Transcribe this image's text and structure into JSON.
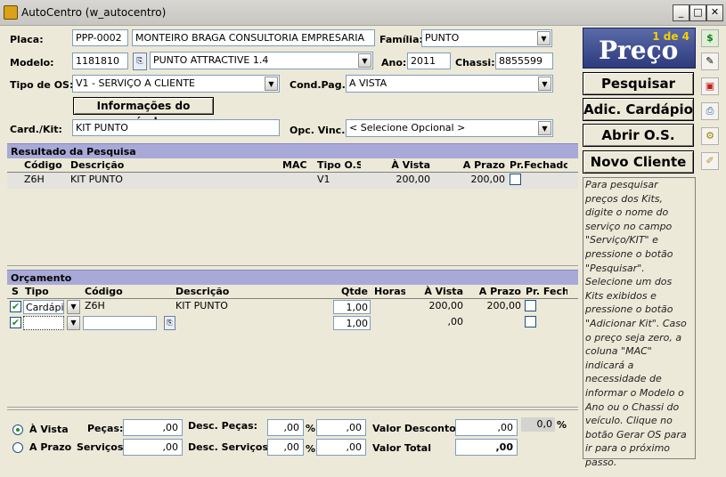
{
  "window": {
    "title": "AutoCentro (w_autocentro)"
  },
  "form": {
    "placa_label": "Placa:",
    "placa": "PPP-0002",
    "cliente": "MONTEIRO BRAGA CONSULTORIA EMPRESARIA",
    "familia_label": "Família:",
    "familia": "PUNTO",
    "modelo_label": "Modelo:",
    "modelo_code": "1181810",
    "modelo": "PUNTO ATTRACTIVE 1.4",
    "ano_label": "Ano:",
    "ano": "2011",
    "chassi_label": "Chassi:",
    "chassi": "8855599",
    "tipo_os_label": "Tipo de OS:",
    "tipo_os": "V1 - SERVIÇO A CLIENTE",
    "cond_pag_label": "Cond.Pag.:",
    "cond_pag": "A VISTA",
    "info_button": "Informações do veículo",
    "card_kit_label": "Card./Kit:",
    "card_kit": "KIT PUNTO",
    "opc_vinc_label": "Opc. Vinc.:",
    "opc_vinc": "< Selecione Opcional >"
  },
  "resultado": {
    "title": "Resultado da Pesquisa",
    "columns": [
      "Código",
      "Descrição",
      "MAC",
      "Tipo O.S",
      "À Vista",
      "A Prazo",
      "Pr.Fechado"
    ],
    "rows": [
      {
        "codigo": "Z6H",
        "descricao": "KIT PUNTO",
        "mac": "",
        "tipo_os": "V1",
        "a_vista": "200,00",
        "a_prazo": "200,00"
      }
    ]
  },
  "orcamento": {
    "title": "Orçamento",
    "columns": [
      "S",
      "Tipo",
      "Código",
      "Descrição",
      "Qtde",
      "Horas",
      "À Vista",
      "A Prazo",
      "Pr. Fech"
    ],
    "rows": [
      {
        "tipo": "Cardápi",
        "codigo": "Z6H",
        "descricao": "KIT PUNTO",
        "qtde": "1,00",
        "horas": "",
        "a_vista": "200,00",
        "a_prazo": "200,00"
      },
      {
        "tipo": "",
        "codigo": "",
        "descricao": "",
        "qtde": "1,00",
        "horas": "",
        "a_vista": ",00",
        "a_prazo": ""
      }
    ]
  },
  "totais": {
    "a_vista_label": "À Vista",
    "a_prazo_label": "A Prazo",
    "pecas_label": "Peças:",
    "pecas": ",00",
    "servicos_label": "Serviços:",
    "servicos": ",00",
    "desc_pecas_label": "Desc. Peças:",
    "desc_pecas_pct": ",00",
    "desc_pecas_val": ",00",
    "desc_servicos_label": "Desc. Serviços:",
    "desc_servicos_pct": ",00",
    "desc_servicos_val": ",00",
    "pct_sign": "%",
    "valor_desconto_label": "Valor Desconto:",
    "valor_desconto": ",00",
    "valor_desconto_pct": "0,0",
    "valor_total_label": "Valor Total",
    "valor_total": ",00"
  },
  "sidebar": {
    "page_indicator": "1 de 4",
    "title": "Preço",
    "pesquisar": "Pesquisar",
    "adic_cardapio": "Adic. Cardápio",
    "abrir_os": "Abrir O.S.",
    "novo_cliente": "Novo Cliente",
    "help": "Para pesquisar preços dos Kits, digite o nome do serviço no campo \"Serviço/KIT\" e pressione o botão \"Pesquisar\". Selecione um dos Kits exibidos e pressione o botão \"Adicionar Kit\". Caso o preço seja zero, a coluna \"MAC\" indicará a necessidade de informar o Modelo o Ano ou o Chassi do veículo. Clique no botão Gerar OS para ir para o próximo passo."
  },
  "toolbar_icons": [
    "dollar-icon",
    "edit-icon",
    "cards-icon",
    "print-icon",
    "gear-icon",
    "pencil-icon"
  ],
  "colors": {
    "section_header": "#a9a9d8",
    "price_box": "#2d3b7c",
    "price_indicator": "#f5d000"
  }
}
